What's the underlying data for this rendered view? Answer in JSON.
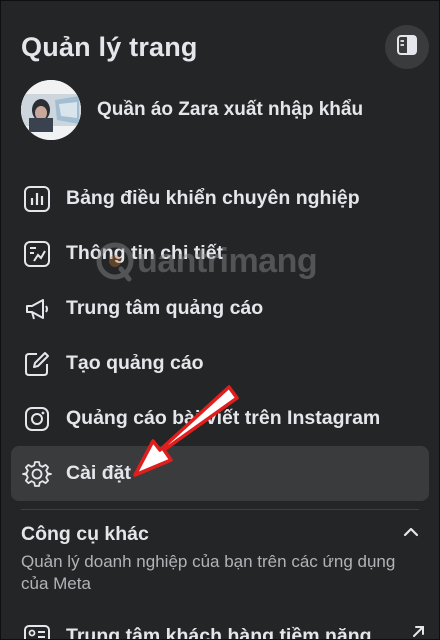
{
  "header": {
    "title": "Quản lý trang"
  },
  "page": {
    "name": "Quần áo Zara xuất nhập khẩu"
  },
  "menu": [
    {
      "label": "Bảng điều khiển chuyên nghiệp",
      "icon": "chart-icon"
    },
    {
      "label": "Thông tin chi tiết",
      "icon": "insights-icon"
    },
    {
      "label": "Trung tâm quảng cáo",
      "icon": "megaphone-icon"
    },
    {
      "label": "Tạo quảng cáo",
      "icon": "pencil-icon"
    },
    {
      "label": "Quảng cáo bài viết trên Instagram",
      "icon": "instagram-icon"
    },
    {
      "label": "Cài đặt",
      "icon": "gear-icon",
      "active": true
    }
  ],
  "other_tools": {
    "title": "Công cụ khác",
    "description": "Quản lý doanh nghiệp của bạn trên các ứng dụng của Meta",
    "items": [
      {
        "label": "Trung tâm khách hàng tiềm năng",
        "icon": "leads-icon"
      }
    ]
  },
  "watermark": {
    "text": "uantrimang"
  },
  "colors": {
    "background": "#242526",
    "active": "#3a3b3c",
    "text": "#e4e6eb",
    "secondary": "#b0b3b8",
    "arrow": "#e01e1e"
  }
}
